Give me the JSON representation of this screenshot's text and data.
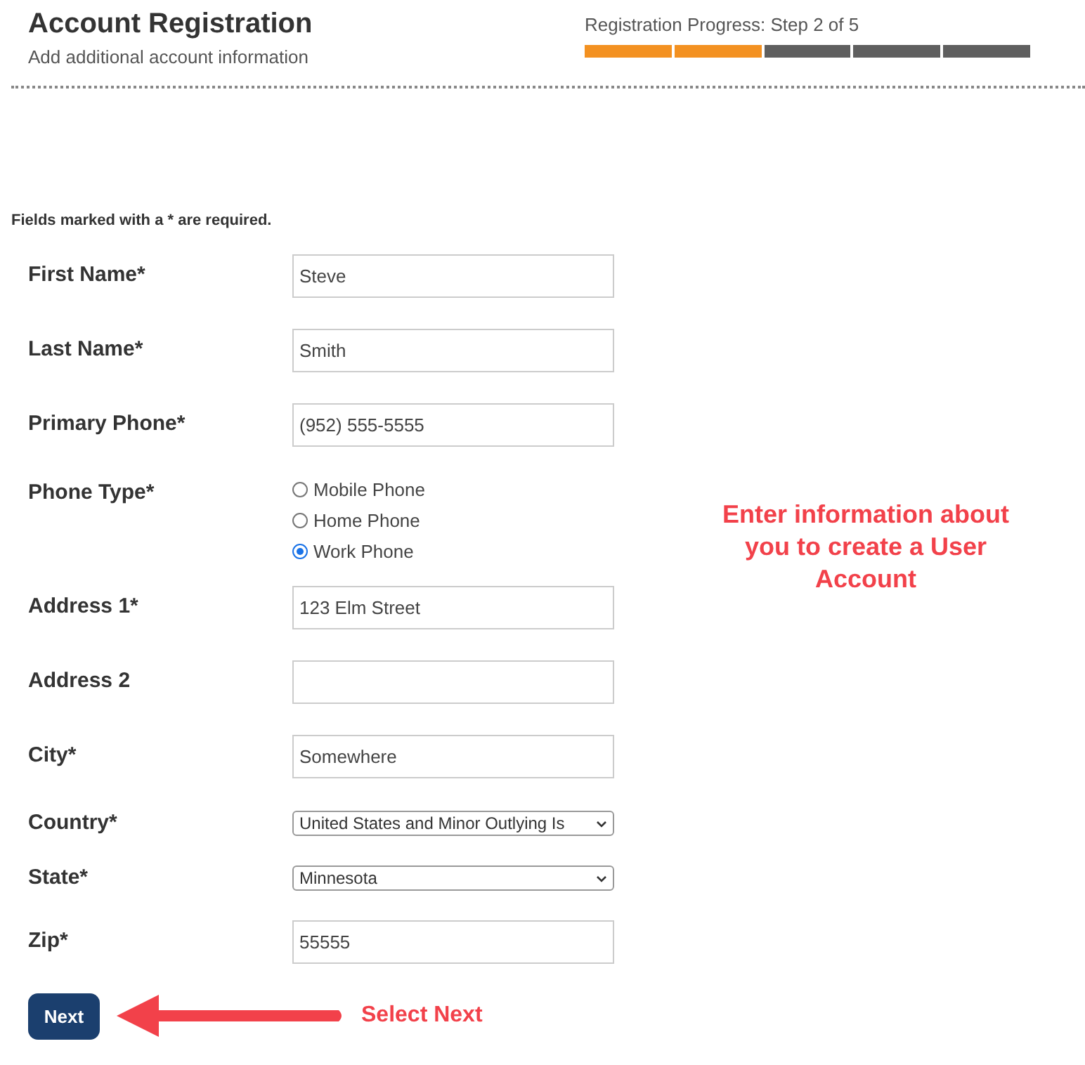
{
  "header": {
    "title": "Account Registration",
    "subtitle": "Add additional account information"
  },
  "progress": {
    "label": "Registration Progress: Step 2 of 5",
    "steps": [
      {
        "complete": true
      },
      {
        "complete": true
      },
      {
        "complete": false
      },
      {
        "complete": false
      },
      {
        "complete": false
      }
    ]
  },
  "required_note": "Fields marked with a * are required.",
  "fields": [
    {
      "kind": "text",
      "label": "First Name*",
      "value": "Steve"
    },
    {
      "kind": "text",
      "label": "Last Name*",
      "value": "Smith"
    },
    {
      "kind": "text",
      "label": "Primary Phone*",
      "value": "(952) 555-5555"
    },
    {
      "kind": "radio",
      "label": "Phone Type*",
      "options": [
        {
          "label": "Mobile Phone",
          "selected": false
        },
        {
          "label": "Home Phone",
          "selected": false
        },
        {
          "label": "Work Phone",
          "selected": true
        }
      ]
    },
    {
      "kind": "text",
      "label": "Address 1*",
      "value": "123 Elm Street"
    },
    {
      "kind": "text",
      "label": "Address 2"
    },
    {
      "kind": "text",
      "label": "City*",
      "value": "Somewhere"
    },
    {
      "kind": "select",
      "label": "Country*",
      "value": "United States and Minor Outlying Is"
    },
    {
      "kind": "select",
      "label": "State*",
      "value": "Minnesota"
    },
    {
      "kind": "text",
      "label": "Zip*",
      "value": "55555"
    }
  ],
  "next_button": "Next",
  "annotations": {
    "side_note": "Enter information about you to create a User Account",
    "button_note": "Select Next"
  }
}
